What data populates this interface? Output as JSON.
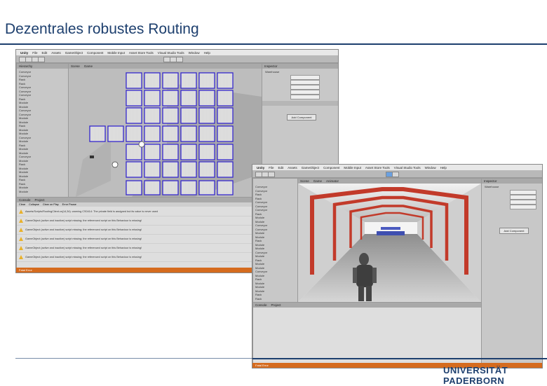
{
  "slide": {
    "title": "Dezentrales robustes Routing",
    "logo_text": "UNIVERSITÄT PADERBORN"
  },
  "editor_top": {
    "menu": [
      "Unity",
      "File",
      "Edit",
      "Assets",
      "GameObject",
      "Component",
      "Mobile Input",
      "Asset Store Tools",
      "Visual Studio Tools",
      "Window",
      "Help"
    ],
    "scene_tabs": [
      "Scene",
      "Game"
    ],
    "hierarchy_tab": "Hierarchy",
    "hierarchy_items": [
      "Conveyor",
      "Conveyor",
      "Rack",
      "Rack",
      "Conveyor",
      "Conveyor",
      "Conveyor",
      "Rack",
      "Module",
      "Module",
      "Conveyor",
      "Conveyor",
      "Module",
      "Module",
      "Rack",
      "Module",
      "Module",
      "Conveyor",
      "Module",
      "Rack",
      "Module",
      "Module",
      "Conveyor",
      "Module",
      "Rack",
      "Module",
      "Module",
      "Module",
      "Rack",
      "Rack",
      "Module",
      "Module"
    ],
    "project_tabs": [
      "Console",
      "Project"
    ],
    "console_buttons": [
      "Clear",
      "Collapse",
      "Clear on Play",
      "Error Pause"
    ],
    "console_rows": [
      "Assets/Scripts/RoutingClient.cs(14,34): warning CS0414: The private field is assigned but its value is never used",
      "GameObject (active and inactive) script missing; the referenced script on this Behaviour is missing!",
      "GameObject (active and inactive) script missing; the referenced script on this Behaviour is missing!",
      "GameObject (active and inactive) script missing; the referenced script on this Behaviour is missing!",
      "GameObject (active and inactive) script missing; the referenced script on this Behaviour is missing!",
      "GameObject (active and inactive) script missing; the referenced script on this Behaviour is missing!"
    ],
    "status_text": "Fatal Error",
    "inspector_tab": "Inspector",
    "inspector_title": "Warehouse",
    "add_component": "Add Component"
  },
  "editor_bottom": {
    "menu": [
      "Unity",
      "File",
      "Edit",
      "Assets",
      "GameObject",
      "Component",
      "Mobile Input",
      "Asset Store Tools",
      "Visual Studio Tools",
      "Window",
      "Help"
    ],
    "scene_tabs": [
      "Scene",
      "Game",
      "Animator"
    ],
    "inspector_tab": "Inspector",
    "inspector_title": "Warehouse",
    "add_component": "Add Component",
    "project_tabs": [
      "Console",
      "Project"
    ],
    "status_text": "Fatal Error"
  },
  "colors": {
    "title": "#1d3f6e",
    "rack_outline": "#3a2ec8",
    "status_bar": "#d56b1e",
    "arch_red": "#c23a2a"
  }
}
